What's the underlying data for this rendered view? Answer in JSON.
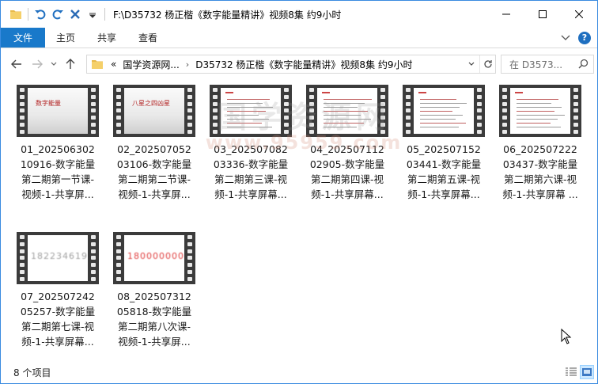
{
  "title_bar": {
    "path": "F:\\D35732 杨正楷《数字能量精讲》视频8集 约9小时"
  },
  "ribbon": {
    "tabs": [
      "文件",
      "主页",
      "共享",
      "查看"
    ]
  },
  "address": {
    "crumbs": [
      "«",
      "国学资源网...",
      "D35732 杨正楷《数字能量精讲》视频8集 约9小时"
    ]
  },
  "search": {
    "placeholder": "在 D3573..."
  },
  "files": [
    {
      "line1": "01_202506302",
      "line2": "10916-数字能量",
      "line3": "第二期第一节课-",
      "line4": "视频-1-共享屏...",
      "thumb": "title-slide",
      "thumb_text": "数字能量"
    },
    {
      "line1": "02_202507052",
      "line2": "03106-数字能量",
      "line3": "第二期第二节课-",
      "line4": "视频-1-共享屏...",
      "thumb": "title-slide",
      "thumb_text": "八星之四凶星"
    },
    {
      "line1": "03_202507082",
      "line2": "03336-数字能量",
      "line3": "第二期第三课-视",
      "line4": "频-1-共享屏幕...",
      "thumb": "text-slide"
    },
    {
      "line1": "04_202507112",
      "line2": "02905-数字能量",
      "line3": "第二期第四课-视",
      "line4": "频-1-共享屏幕...",
      "thumb": "text-slide"
    },
    {
      "line1": "05_202507152",
      "line2": "03441-数字能量",
      "line3": "第二期第五课-视",
      "line4": "频-1-共享屏幕...",
      "thumb": "text-slide"
    },
    {
      "line1": "06_202507222",
      "line2": "03437-数字能量",
      "line3": "第二期第六课-视",
      "line4": "频-1-共享屏幕 ...",
      "thumb": "text-slide"
    },
    {
      "line1": "07_202507242",
      "line2": "05257-数字能量",
      "line3": "第二期第七课-视",
      "line4": "频-1-共享屏幕...",
      "thumb": "number-slide",
      "thumb_text": "18223461995"
    },
    {
      "line1": "08_202507312",
      "line2": "05818-数字能量",
      "line3": "第二期第八次课-",
      "line4": "视频-1-共享屏...",
      "thumb": "number-slide-red",
      "thumb_text": "18000000007"
    }
  ],
  "watermark": {
    "line1": "国学资源网",
    "line2": "www.95959.com"
  },
  "status": {
    "count": "8 个项目"
  },
  "colors": {
    "accent": "#1979ca",
    "frame": "#3b3b3b"
  }
}
